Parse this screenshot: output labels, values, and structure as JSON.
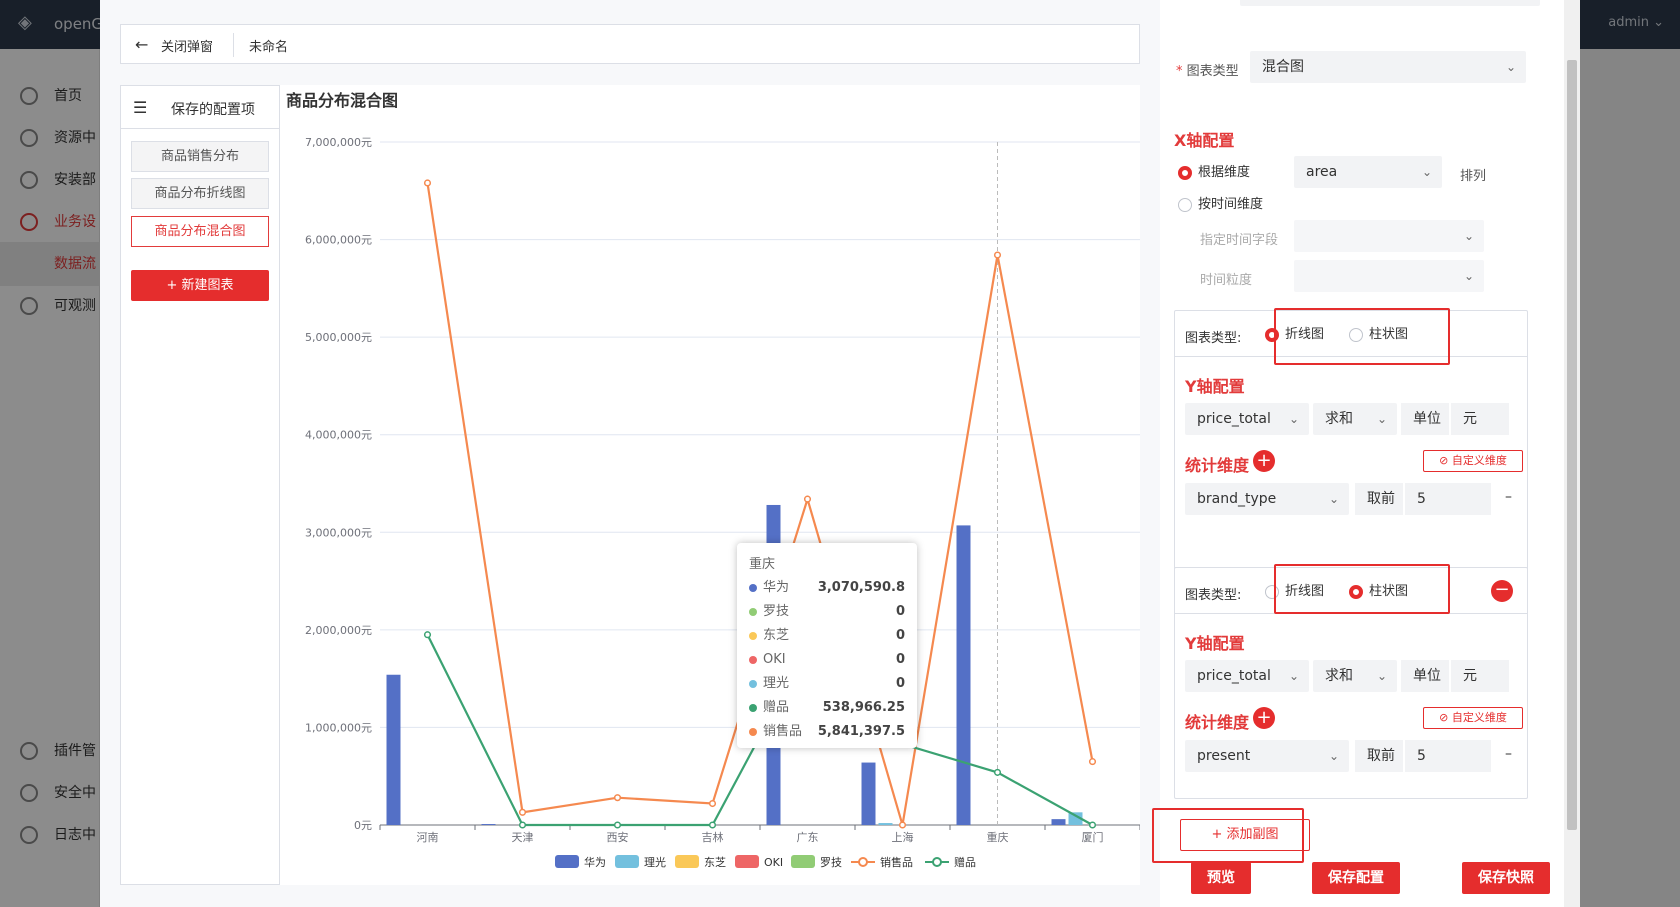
{
  "app": {
    "logo_text": "openG",
    "user": "admin ⌄"
  },
  "sidebar": {
    "items": [
      {
        "label": "首页"
      },
      {
        "label": "资源中"
      },
      {
        "label": "安装部"
      },
      {
        "label": "业务设"
      },
      {
        "label": "数据流"
      },
      {
        "label": "可观测"
      },
      {
        "label": "插件管"
      },
      {
        "label": "安全中"
      },
      {
        "label": "日志中"
      }
    ]
  },
  "header": {
    "close_label": "关闭弹窗",
    "name": "未命名"
  },
  "config_panel": {
    "title": "保存的配置项",
    "items": [
      "商品销售分布",
      "商品分布折线图",
      "商品分布混合图"
    ],
    "new_chart": "+ 新建图表"
  },
  "chart_data": {
    "type": "bar",
    "title": "商品分布混合图",
    "categories": [
      "河南",
      "天津",
      "西安",
      "吉林",
      "广东",
      "上海",
      "重庆",
      "厦门"
    ],
    "y_tick_labels": [
      "0元",
      "1,000,000元",
      "2,000,000元",
      "3,000,000元",
      "4,000,000元",
      "5,000,000元",
      "6,000,000元",
      "7,000,000元"
    ],
    "ylim": [
      0,
      7000000
    ],
    "grid": true,
    "legend_position": "bottom",
    "series": [
      {
        "name": "华为",
        "kind": "bar",
        "color": "#5470c6",
        "values": [
          1540000,
          10000,
          0,
          0,
          3280000,
          640000,
          3070590.8,
          60000
        ]
      },
      {
        "name": "理光",
        "kind": "bar",
        "color": "#73c0de",
        "values": [
          0,
          0,
          0,
          0,
          0,
          20000,
          0,
          130000
        ]
      },
      {
        "name": "东芝",
        "kind": "bar",
        "color": "#fac858",
        "values": [
          0,
          0,
          0,
          0,
          0,
          0,
          0,
          0
        ]
      },
      {
        "name": "OKI",
        "kind": "bar",
        "color": "#ee6666",
        "values": [
          0,
          0,
          0,
          0,
          0,
          0,
          0,
          0
        ]
      },
      {
        "name": "罗技",
        "kind": "bar",
        "color": "#91cc75",
        "values": [
          0,
          0,
          0,
          0,
          0,
          0,
          0,
          0
        ]
      },
      {
        "name": "销售品",
        "kind": "line",
        "color": "#f5894f",
        "values": [
          6580000,
          130000,
          280000,
          220000,
          3340000,
          0,
          5841397.5,
          650000
        ]
      },
      {
        "name": "赠品",
        "kind": "line",
        "color": "#3ba272",
        "values": [
          1950000,
          0,
          0,
          0,
          1820000,
          830000,
          538966.25,
          0
        ]
      }
    ]
  },
  "tooltip": {
    "title": "重庆",
    "rows": [
      {
        "name": "华为",
        "value": "3,070,590.8",
        "color": "#5470c6"
      },
      {
        "name": "罗技",
        "value": "0",
        "color": "#91cc75"
      },
      {
        "name": "东芝",
        "value": "0",
        "color": "#fac858"
      },
      {
        "name": "OKI",
        "value": "0",
        "color": "#ee6666"
      },
      {
        "name": "理光",
        "value": "0",
        "color": "#73c0de"
      },
      {
        "name": "赠品",
        "value": "538,966.25",
        "color": "#3ba272"
      },
      {
        "name": "销售品",
        "value": "5,841,397.5",
        "color": "#f5894f"
      }
    ]
  },
  "form": {
    "chart_type_label": "图表类型",
    "chart_type_value": "混合图",
    "x_axis_title": "X轴配置",
    "by_dimension": "根据维度",
    "dimension_value": "area",
    "sort_label": "排列",
    "by_time": "按时间维度",
    "time_field_label": "指定时间字段",
    "time_grain_label": "时间粒度",
    "sub_charts": [
      {
        "type_label": "图表类型:",
        "line_label": "折线图",
        "bar_label": "柱状图",
        "selected": "line",
        "y_title": "Y轴配置",
        "y_field": "price_total",
        "agg": "求和",
        "unit_label": "单位",
        "unit_value": "元",
        "dim_title": "统计维度",
        "custom_label": "自定义维度",
        "dim_field": "brand_type",
        "take_label": "取前",
        "take_value": "5"
      },
      {
        "type_label": "图表类型:",
        "line_label": "折线图",
        "bar_label": "柱状图",
        "selected": "bar",
        "y_title": "Y轴配置",
        "y_field": "price_total",
        "agg": "求和",
        "unit_label": "单位",
        "unit_value": "元",
        "dim_title": "统计维度",
        "custom_label": "自定义维度",
        "dim_field": "present",
        "take_label": "取前",
        "take_value": "5"
      }
    ],
    "add_sub_chart": "+ 添加副图"
  },
  "footer": {
    "preview": "预览",
    "save_config": "保存配置",
    "save_snapshot": "保存快照"
  }
}
